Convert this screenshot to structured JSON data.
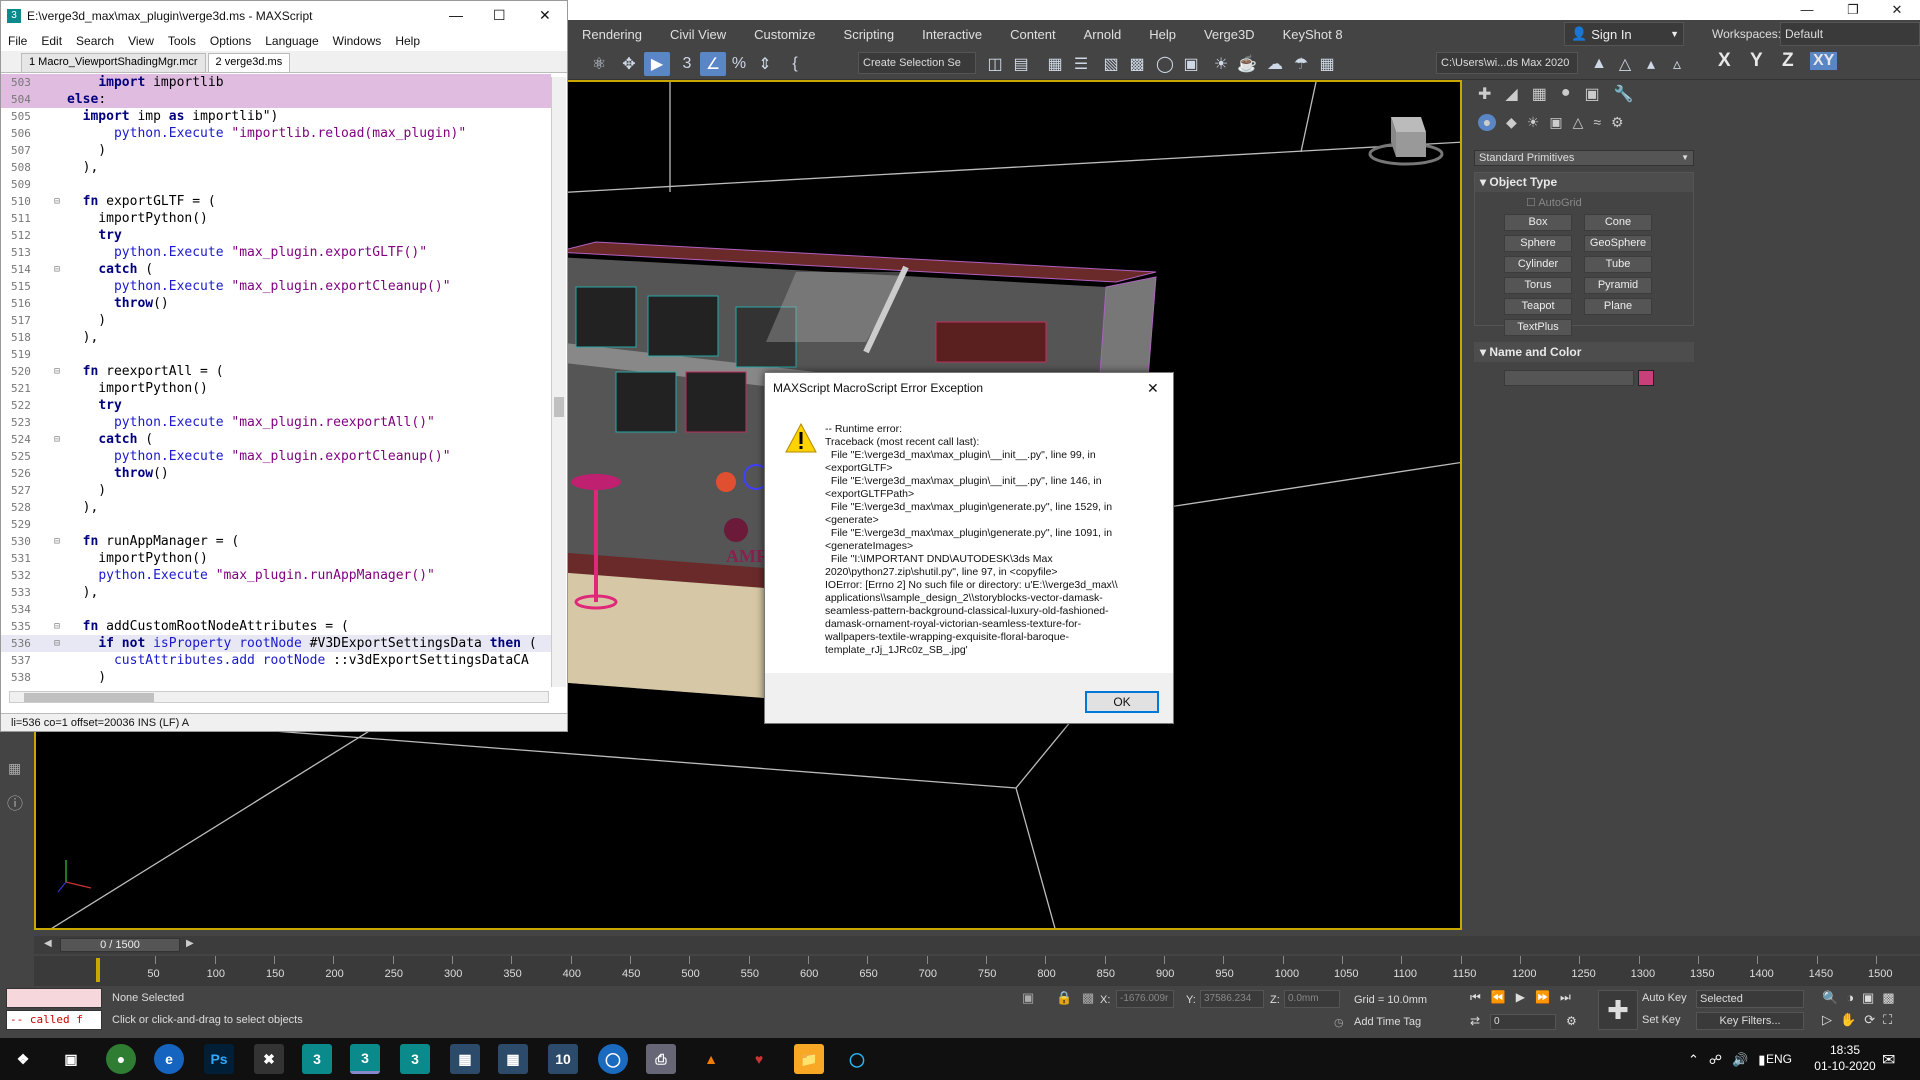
{
  "max": {
    "menu": [
      "Rendering",
      "Civil View",
      "Customize",
      "Scripting",
      "Interactive",
      "Content",
      "Arnold",
      "Help",
      "Verge3D",
      "KeyShot 8"
    ],
    "sign_in": "Sign In",
    "workspaces_label": "Workspaces:",
    "workspace": "Default",
    "selection_set": "Create Selection Se",
    "path": "C:\\Users\\wi...ds Max 2020",
    "axes": [
      "X",
      "Y",
      "Z",
      "XY"
    ],
    "command_panel": {
      "dropdown": "Standard Primitives",
      "object_type": "Object Type",
      "autogrid": "AutoGrid",
      "primitives": [
        "Box",
        "Cone",
        "Sphere",
        "GeoSphere",
        "Cylinder",
        "Tube",
        "Torus",
        "Pyramid",
        "Teapot",
        "Plane",
        "TextPlus"
      ],
      "name_and_color": "Name and Color",
      "color": "#c8407a"
    },
    "timeline": {
      "slider": "0 / 1500",
      "ticks": [
        "50",
        "100",
        "150",
        "200",
        "250",
        "300",
        "350",
        "400",
        "450",
        "500",
        "550",
        "600",
        "650",
        "700",
        "750",
        "800",
        "850",
        "900",
        "950",
        "1000",
        "1050",
        "1100",
        "1150",
        "1200",
        "1250",
        "1300",
        "1350",
        "1400",
        "1450",
        "1500"
      ]
    },
    "status": {
      "selection": "None Selected",
      "hint": "Click or click-and-drag to select objects",
      "listener": "-- called f",
      "x_label": "X:",
      "x_value": "-1676.009r",
      "y_label": "Y:",
      "y_value": "37586.234",
      "z_label": "Z:",
      "z_value": "0.0mm",
      "grid": "Grid = 10.0mm",
      "add_time_tag": "Add Time Tag",
      "auto_key": "Auto Key",
      "set_key": "Set Key",
      "key_mode": "Selected",
      "key_filters": "Key Filters...",
      "frame": "0"
    },
    "viewport_label_text": "AMRAJ JEWELLERS"
  },
  "editor": {
    "title": "E:\\verge3d_max\\max_plugin\\verge3d.ms - MAXScript",
    "menu": [
      "File",
      "Edit",
      "Search",
      "View",
      "Tools",
      "Options",
      "Language",
      "Windows",
      "Help"
    ],
    "tabs": [
      "1 Macro_ViewportShadingMgr.mcr",
      "2 verge3d.ms"
    ],
    "status": "li=536 co=1 offset=20036 INS (LF) A",
    "lines": [
      {
        "no": "503",
        "code": "    import importlib"
      },
      {
        "no": "504",
        "code": "else:"
      },
      {
        "no": "505",
        "code": "  import imp as importlib\")"
      },
      {
        "no": "506",
        "code": "      python.Execute \"importlib.reload(max_plugin)\""
      },
      {
        "no": "507",
        "code": "    )"
      },
      {
        "no": "508",
        "code": "  ),"
      },
      {
        "no": "509",
        "code": ""
      },
      {
        "no": "510",
        "code": "  fn exportGLTF = ("
      },
      {
        "no": "511",
        "code": "    importPython()"
      },
      {
        "no": "512",
        "code": "    try"
      },
      {
        "no": "513",
        "code": "      python.Execute \"max_plugin.exportGLTF()\""
      },
      {
        "no": "514",
        "code": "    catch ("
      },
      {
        "no": "515",
        "code": "      python.Execute \"max_plugin.exportCleanup()\""
      },
      {
        "no": "516",
        "code": "      throw()"
      },
      {
        "no": "517",
        "code": "    )"
      },
      {
        "no": "518",
        "code": "  ),"
      },
      {
        "no": "519",
        "code": ""
      },
      {
        "no": "520",
        "code": "  fn reexportAll = ("
      },
      {
        "no": "521",
        "code": "    importPython()"
      },
      {
        "no": "522",
        "code": "    try"
      },
      {
        "no": "523",
        "code": "      python.Execute \"max_plugin.reexportAll()\""
      },
      {
        "no": "524",
        "code": "    catch ("
      },
      {
        "no": "525",
        "code": "      python.Execute \"max_plugin.exportCleanup()\""
      },
      {
        "no": "526",
        "code": "      throw()"
      },
      {
        "no": "527",
        "code": "    )"
      },
      {
        "no": "528",
        "code": "  ),"
      },
      {
        "no": "529",
        "code": ""
      },
      {
        "no": "530",
        "code": "  fn runAppManager = ("
      },
      {
        "no": "531",
        "code": "    importPython()"
      },
      {
        "no": "532",
        "code": "    python.Execute \"max_plugin.runAppManager()\""
      },
      {
        "no": "533",
        "code": "  ),"
      },
      {
        "no": "534",
        "code": ""
      },
      {
        "no": "535",
        "code": "  fn addCustomRootNodeAttributes = ("
      },
      {
        "no": "536",
        "code": "    if not isProperty rootNode #V3DExportSettingsData then ("
      },
      {
        "no": "537",
        "code": "      custAttributes.add rootNode ::v3dExportSettingsDataCA"
      },
      {
        "no": "538",
        "code": "    )"
      }
    ]
  },
  "dialog": {
    "title": "MAXScript MacroScript Error Exception",
    "message": "-- Runtime error:\nTraceback (most recent call last):\n  File \"E:\\verge3d_max\\max_plugin\\__init__.py\", line 99, in\n<exportGLTF>\n  File \"E:\\verge3d_max\\max_plugin\\__init__.py\", line 146, in\n<exportGLTFPath>\n  File \"E:\\verge3d_max\\max_plugin\\generate.py\", line 1529, in\n<generate>\n  File \"E:\\verge3d_max\\max_plugin\\generate.py\", line 1091, in\n<generateImages>\n  File \"I:\\IMPORTANT DND\\AUTODESK\\3ds Max\n2020\\python27.zip\\shutil.py\", line 97, in <copyfile>\nIOError: [Errno 2] No such file or directory: u'E:\\\\verge3d_max\\\\\napplications\\\\sample_design_2\\\\storyblocks-vector-damask-\nseamless-pattern-background-classical-luxury-old-fashioned-\ndamask-ornament-royal-victorian-seamless-texture-for-\nwallpapers-textile-wrapping-exquisite-floral-baroque-\ntemplate_rJj_1JRc0z_SB_.jpg'",
    "ok": "OK"
  },
  "taskbar": {
    "lang": "ENG",
    "time": "18:35",
    "date": "01-10-2020"
  }
}
